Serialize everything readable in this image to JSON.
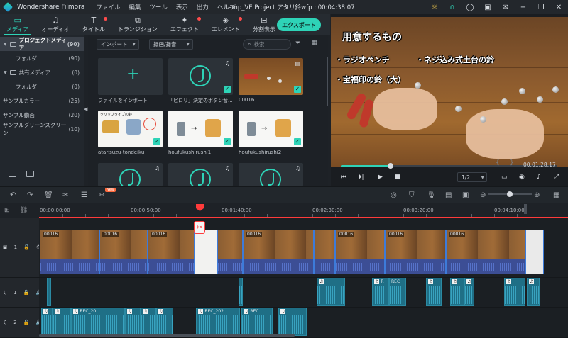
{
  "titlebar": {
    "app_name": "Wondershare Filmora",
    "menu": [
      "ファイル",
      "編集",
      "ツール",
      "表示",
      "出力",
      "ヘルプ"
    ],
    "project_title": "temp_VE Project アタリ鈴wfp : 00:04:38:07"
  },
  "toolbar": {
    "tabs": [
      {
        "label": "メディア",
        "icon": "folder-icon",
        "active": true
      },
      {
        "label": "オーディオ",
        "icon": "music-note-icon"
      },
      {
        "label": "タイトル",
        "icon": "text-icon",
        "badge": true
      },
      {
        "label": "トランジション",
        "icon": "transition-icon"
      },
      {
        "label": "エフェクト",
        "icon": "effect-icon",
        "badge": true
      },
      {
        "label": "エレメント",
        "icon": "element-icon",
        "badge": true
      },
      {
        "label": "分割表示",
        "icon": "split-screen-icon"
      }
    ],
    "export_label": "エクスポート"
  },
  "sidebar": {
    "items": [
      {
        "label": "プロジェクトメディア",
        "count": "(90)"
      },
      {
        "label": "フォルダ",
        "count": "(90)"
      },
      {
        "label": "共有メディア",
        "count": "(0)"
      },
      {
        "label": "フォルダ",
        "count": "(0)"
      },
      {
        "label": "サンプルカラー",
        "count": "(25)"
      },
      {
        "label": "サンプル動画",
        "count": "(20)"
      },
      {
        "label": "サンプルグリーンスクリーン",
        "count": "(10)"
      }
    ]
  },
  "media": {
    "import_dropdown": "インポート",
    "record_dropdown": "録画/録音",
    "search_placeholder": "検索",
    "items": [
      {
        "label": "ファイルをインポート",
        "kind": "import"
      },
      {
        "label": "「ピロリ」決定のボタン音...",
        "kind": "audio"
      },
      {
        "label": "00016",
        "kind": "video"
      },
      {
        "label": "atarisuzu-tondeiku",
        "kind": "image"
      },
      {
        "label": "houfukushirushi1",
        "kind": "image"
      },
      {
        "label": "houfukushirushi2",
        "kind": "image"
      }
    ],
    "atarisuzu_caption": "クリップタイプの鈴"
  },
  "preview": {
    "caption_title": "用意するもの",
    "caption_items": [
      "・ラジオペンチ",
      "・ネジ込み式土台の鈴",
      "・宝福印の鈴（大）"
    ],
    "progress": 0.23,
    "timecode": "00:01:28:17",
    "zoom_label": "1/2",
    "bracket_left": "{",
    "bracket_right": "}"
  },
  "timeline": {
    "ruler_labels": [
      "00:00:00:00",
      "00:00:50:00",
      "00:01:40:00",
      "00:02:30:00",
      "00:03:20:00",
      "00:04:10:00"
    ],
    "new_badge": "New",
    "video_clip_label": "00016",
    "audio1_label": "R",
    "audio1_rec_label": "REC",
    "audio2_labels": [
      "REC_20",
      "REC_202",
      "REC"
    ],
    "track_heads": [
      "1",
      "1",
      "2"
    ]
  },
  "colors": {
    "accent": "#2ed3b7",
    "playhead": "#ff3b3b"
  }
}
